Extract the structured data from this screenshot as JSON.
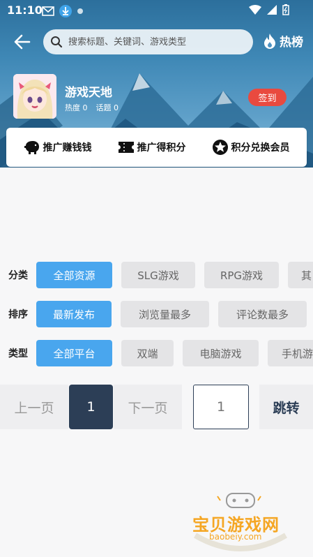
{
  "status_bar": {
    "time": "11:10"
  },
  "header": {
    "search_placeholder": "搜索标题、关键词、游戏类型",
    "hot_label": "热榜"
  },
  "forum": {
    "name": "游戏天地",
    "heat_label": "热度",
    "heat_value": "0",
    "topics_label": "话题",
    "topics_value": "0",
    "checkin_label": "签到"
  },
  "actions": [
    {
      "label": "推广赚钱钱",
      "icon": "piggy-bank-icon"
    },
    {
      "label": "推广得积分",
      "icon": "ticket-icon"
    },
    {
      "label": "积分兑换会员",
      "icon": "star-icon"
    }
  ],
  "filters": {
    "category": {
      "label": "分类",
      "options": [
        "全部资源",
        "SLG游戏",
        "RPG游戏",
        "其"
      ],
      "active": 0
    },
    "sort": {
      "label": "排序",
      "options": [
        "最新发布",
        "浏览量最多",
        "评论数最多"
      ],
      "active": 0
    },
    "type": {
      "label": "类型",
      "options": [
        "全部平台",
        "双端",
        "电脑游戏",
        "手机游"
      ],
      "active": 0
    }
  },
  "pager": {
    "prev": "上一页",
    "current": "1",
    "next": "下一页",
    "input_placeholder": "1",
    "go": "跳转"
  },
  "watermark": {
    "title": "宝贝游戏网",
    "url": "baobeiy.com"
  },
  "colors": {
    "accent": "#49a6ee",
    "pager_dark": "#2c3e56",
    "checkin": "#e94a3f",
    "watermark": "#f5a623"
  }
}
